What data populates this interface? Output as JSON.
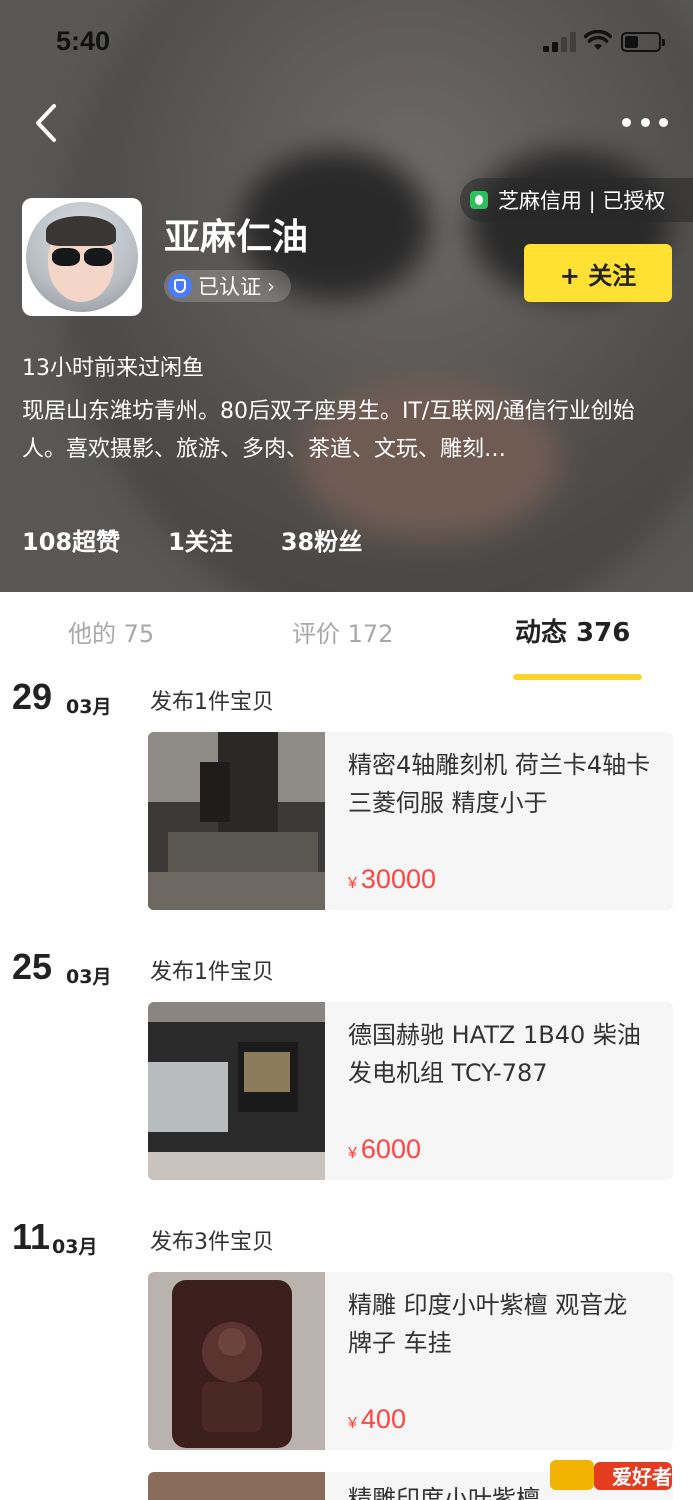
{
  "status_bar": {
    "time": "5:40"
  },
  "header": {
    "zhima_label": "芝麻信用 | 已授权",
    "username": "亚麻仁油",
    "verified_label": "已认证",
    "follow_label": "+ 关注",
    "last_seen": "13小时前来过闲鱼",
    "bio": "现居山东潍坊青州。80后双子座男生。IT/互联网/通信行业创始人。喜欢摄影、旅游、多肉、茶道、文玩、雕刻…",
    "stats": [
      "108超赞",
      "1关注",
      "38粉丝"
    ]
  },
  "tabs": [
    {
      "label": "他的 75",
      "active": false
    },
    {
      "label": "评价 172",
      "active": false
    },
    {
      "label": "动态 376",
      "active": true
    }
  ],
  "feed": [
    {
      "day": "29",
      "month": "03月",
      "action": "发布1件宝贝",
      "item": {
        "title": "精密4轴雕刻机 荷兰卡4轴卡 三菱伺服 精度小于",
        "currency": "¥",
        "price": "30000"
      }
    },
    {
      "day": "25",
      "month": "03月",
      "action": "发布1件宝贝",
      "item": {
        "title": "德国赫驰 HATZ 1B40 柴油发电机组 TCY-787",
        "currency": "¥",
        "price": "6000"
      }
    },
    {
      "day": "11",
      "month": "03月",
      "action": "发布3件宝贝",
      "item": {
        "title": "精雕 印度小叶紫檀 观音龙 牌子 车挂",
        "currency": "¥",
        "price": "400"
      }
    }
  ],
  "partial_next_title": "精雕印度小叶紫檀 ...",
  "watermark_text": "爱好者",
  "colors": {
    "accent_yellow": "#ffe033",
    "tab_indicator": "#ffd427",
    "price_red": "#ff4444"
  }
}
